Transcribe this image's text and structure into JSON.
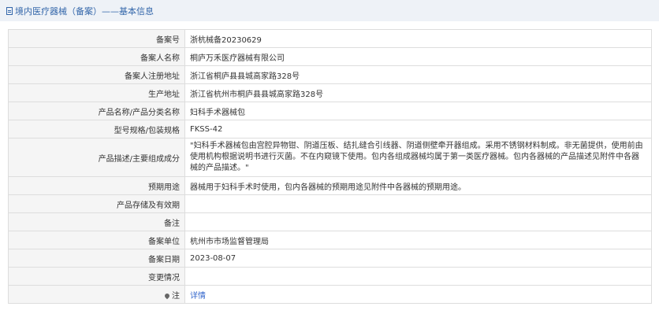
{
  "header": {
    "title": "境内医疗器械（备案）",
    "subtitle": "——基本信息"
  },
  "rows": [
    {
      "label": "备案号",
      "value": "浙杭械备20230629"
    },
    {
      "label": "备案人名称",
      "value": "桐庐万禾医疗器械有限公司"
    },
    {
      "label": "备案人注册地址",
      "value": "浙江省桐庐县县城高家路328号"
    },
    {
      "label": "生产地址",
      "value": "浙江省杭州市桐庐县县城高家路328号"
    },
    {
      "label": "产品名称/产品分类名称",
      "value": "妇科手术器械包"
    },
    {
      "label": "型号规格/包装规格",
      "value": "FKSS-42"
    },
    {
      "label": "产品描述/主要组成成分",
      "value": "\"妇科手术器械包由宫腔异物钳、阴道压板、结扎缝合引线器、阴道侧壁牵开器组成。采用不锈钢材料制成。非无菌提供，使用前由使用机构根据说明书进行灭菌。不在内窥镜下使用。包内各组成器械均属于第一类医疗器械。包内各器械的产品描述见附件中各器械的产品描述。\""
    },
    {
      "label": "预期用途",
      "value": "器械用于妇科手术时使用，包内各器械的预期用途见附件中各器械的预期用途。"
    },
    {
      "label": "产品存储及有效期",
      "value": ""
    },
    {
      "label": "备注",
      "value": ""
    },
    {
      "label": "备案单位",
      "value": "杭州市市场监督管理局"
    },
    {
      "label": "备案日期",
      "value": "2023-08-07"
    },
    {
      "label": "变更情况",
      "value": ""
    },
    {
      "label": "注",
      "value": "详情"
    }
  ],
  "icons": {
    "header": "document-icon",
    "note": "pin-icon"
  }
}
